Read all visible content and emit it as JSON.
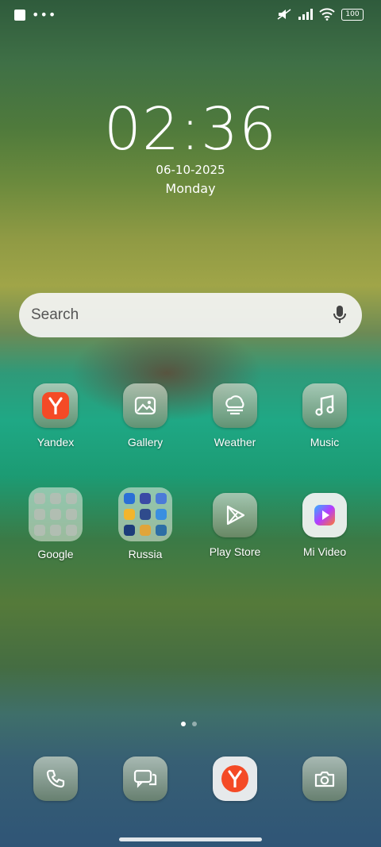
{
  "status_bar": {
    "battery": "100"
  },
  "clock": {
    "time": "02:36",
    "date": "06-10-2025",
    "day": "Monday"
  },
  "search": {
    "placeholder": "Search"
  },
  "apps_row1": [
    {
      "label": "Yandex"
    },
    {
      "label": "Gallery"
    },
    {
      "label": "Weather"
    },
    {
      "label": "Music"
    }
  ],
  "apps_row2": [
    {
      "label": "Google"
    },
    {
      "label": "Russia"
    },
    {
      "label": "Play Store"
    },
    {
      "label": "Mi Video"
    }
  ],
  "dock": [
    {
      "icon": "phone-icon"
    },
    {
      "icon": "messages-icon"
    },
    {
      "icon": "yandex-browser-icon"
    },
    {
      "icon": "camera-icon"
    }
  ],
  "pages": {
    "count": 2,
    "current": 1
  },
  "colors": {
    "yandex_red": "#f44a26",
    "search_bg": "#f2f2f2"
  }
}
